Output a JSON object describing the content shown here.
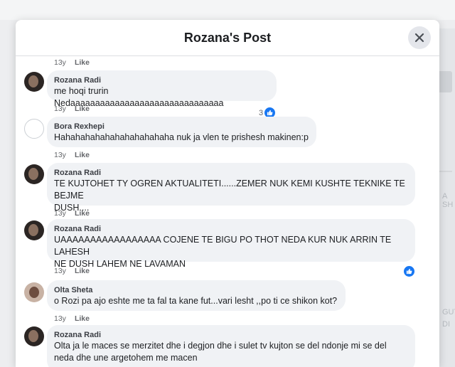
{
  "modal": {
    "title": "Rozana's Post"
  },
  "comments": [
    {
      "author": "",
      "lines": [],
      "time": "13y",
      "like": "Like",
      "reactions": ""
    },
    {
      "author": "Rozana Radi",
      "lines": [
        "me hoqi trurin Nedaaaaaaaaaaaaaaaaaaaaaaaaaaaaaaa"
      ],
      "time": "13y",
      "like": "Like",
      "reactions": "3"
    },
    {
      "author": "Bora Rexhepi",
      "lines": [
        "Hahahahahahahahahahahaha nuk ja vlen te prishesh makinen:p"
      ],
      "time": "13y",
      "like": "Like",
      "reactions": ""
    },
    {
      "author": "Rozana Radi",
      "lines": [
        "TE KUJTOHET TY OGREN AKTUALITETI......ZEMER NUK KEMI KUSHTE TEKNIKE TE BEJME",
        "DUSH...."
      ],
      "time": "13y",
      "like": "Like",
      "reactions": ""
    },
    {
      "author": "Rozana Radi",
      "lines": [
        "UAAAAAAAAAAAAAAAAA COJENE TE BIGU PO THOT NEDA KUR NUK ARRIN TE LAHESH",
        "NE DUSH LAHEM NE LAVAMAN"
      ],
      "time": "13y",
      "like": "Like",
      "reactions": ""
    },
    {
      "author": "Olta Sheta",
      "lines": [
        "o Rozi pa ajo eshte me ta fal ta kane fut...vari lesht ,,po ti ce shikon kot?"
      ],
      "time": "13y",
      "like": "Like",
      "reactions": ""
    },
    {
      "author": "Rozana Radi",
      "lines": [
        "Olta ja le maces se merzitet dhe i degjon dhe i sulet tv kujton se del ndonje mi se del",
        "neda dhe une argetohem me macen"
      ],
      "time": "",
      "like": "",
      "reactions": ""
    }
  ],
  "background": {
    "right_text_1": "A SH",
    "right_text_2": "GUT",
    "right_text_3": "DI"
  }
}
